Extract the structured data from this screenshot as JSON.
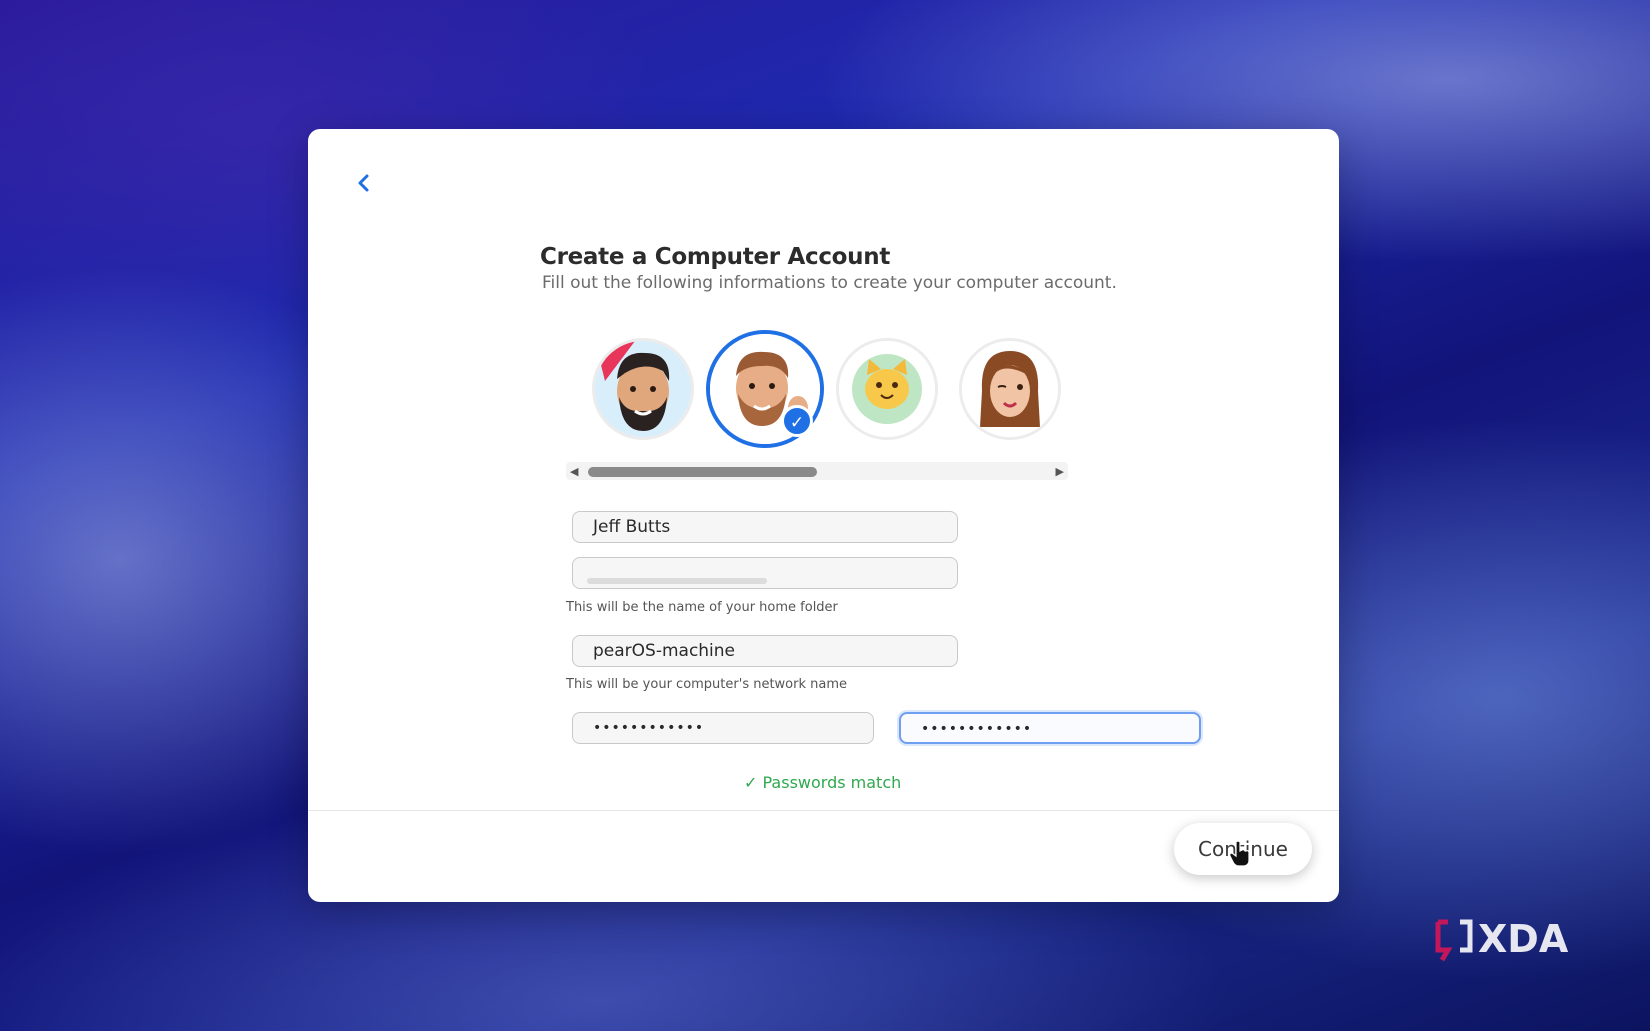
{
  "header": {
    "back_icon": "chevron-left-icon",
    "title": "Create a Computer Account",
    "subtitle": "Fill out the following informations to create your computer account."
  },
  "avatars": [
    {
      "name": "memoji-man-dark-beard",
      "selected": false
    },
    {
      "name": "memoji-man-ginger-beard",
      "selected": true
    },
    {
      "name": "cat-emoji",
      "selected": false
    },
    {
      "name": "memoji-woman-wink",
      "selected": false
    }
  ],
  "avatar_scroll": {
    "left_icon": "scroll-left-arrow-icon",
    "right_icon": "scroll-right-arrow-icon",
    "position_fraction": 0.0,
    "visible_fraction": 0.5
  },
  "form": {
    "full_name_value": "Jeff Butts",
    "account_name_value": "",
    "account_name_hint": "This will be the name of your home folder",
    "computer_name_value": "pearOS-machine",
    "computer_name_hint": "This will be your computer's network name",
    "password_mask": "••••••••••••",
    "verify_password_mask": "••••••••••••",
    "password_status": "✓  Passwords match"
  },
  "footer": {
    "continue_label": "Continue"
  },
  "watermark": "XDA",
  "colors": {
    "accent": "#1f6fe5",
    "success": "#2fa84f"
  }
}
